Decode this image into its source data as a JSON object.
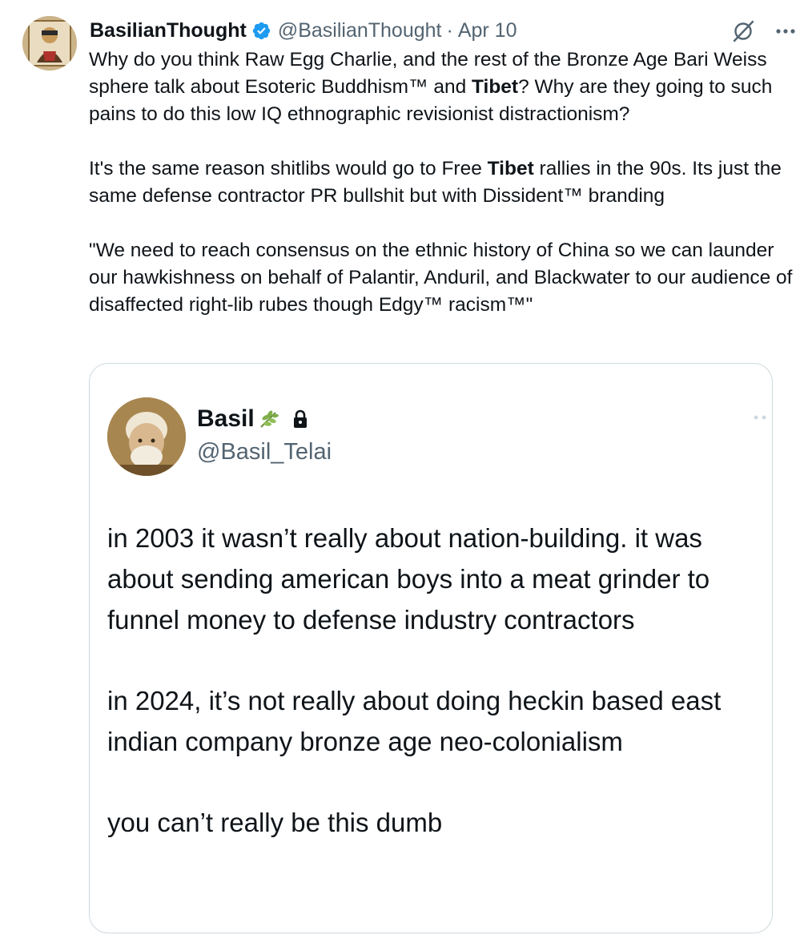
{
  "tweet": {
    "display_name": "BasilianThought",
    "handle": "@BasilianThought",
    "separator": "·",
    "date": "Apr 10",
    "paragraphs": [
      [
        {
          "text": "Why do you think Raw Egg Charlie, and the rest of the Bronze Age Bari Weiss sphere talk about Esoteric Buddhism™ and ",
          "bold": false
        },
        {
          "text": "Tibet",
          "bold": true
        },
        {
          "text": "? Why are they going to such pains to do this low IQ ethnographic revisionist distractionism?",
          "bold": false
        }
      ],
      [
        {
          "text": "It's the same reason shitlibs would go to Free ",
          "bold": false
        },
        {
          "text": "Tibet",
          "bold": true
        },
        {
          "text": " rallies in the 90s. Its just the same defense contractor PR bullshit but with Dissident™ branding",
          "bold": false
        }
      ],
      [
        {
          "text": "\"We need to reach consensus on the ethnic history of China so we can launder our hawkishness on behalf of Palantir, Anduril, and Blackwater to our audience of disaffected right-lib rubes though Edgy™ racism™\"",
          "bold": false
        }
      ]
    ]
  },
  "quote": {
    "display_name": "Basil",
    "handle": "@Basil_Telai",
    "paragraphs": [
      "in 2003 it wasn’t really about nation-building. it was about sending american boys into a meat grinder to funnel money to defense industry contractors",
      "in 2024, it’s not really about doing heckin based east indian company bronze age neo-colonialism",
      "you can’t really be this dumb"
    ]
  },
  "icons": {
    "verified": "verified-badge-icon",
    "grok": "grok-icon",
    "more": "more-icon",
    "leaf": "herb-leaf-icon",
    "lock": "lock-icon"
  },
  "colors": {
    "text": "#0f1419",
    "secondary": "#536471",
    "verified": "#1d9bf0",
    "border": "#cfd9de"
  }
}
